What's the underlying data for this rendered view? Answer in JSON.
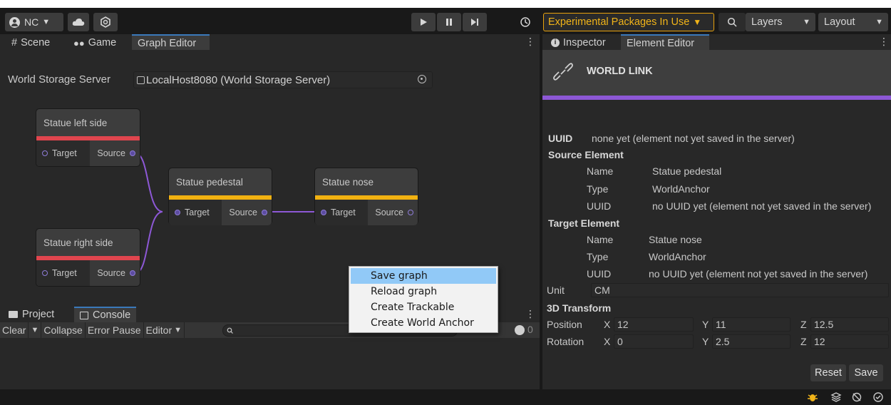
{
  "toolbar": {
    "account_label": "NC",
    "experimental_label": "Experimental Packages In Use",
    "layers_label": "Layers",
    "layout_label": "Layout"
  },
  "left_tabs": {
    "scene": "Scene",
    "game": "Game",
    "graph_editor": "Graph Editor"
  },
  "graph": {
    "world_storage_label": "World Storage Server",
    "world_storage_value": "LocalHost8080 (World Storage Server)",
    "nodes": [
      {
        "title": "Statue left side",
        "target": "Target",
        "source": "Source",
        "color": "#e0454e"
      },
      {
        "title": "Statue pedestal",
        "target": "Target",
        "source": "Source",
        "color": "#f2b211"
      },
      {
        "title": "Statue nose",
        "target": "Target",
        "source": "Source",
        "color": "#f2b211"
      },
      {
        "title": "Statue right side",
        "target": "Target",
        "source": "Source",
        "color": "#e0454e"
      }
    ],
    "link_color": "#8d58d6"
  },
  "context_menu": {
    "items": [
      "Save graph",
      "Reload graph",
      "Create Trackable",
      "Create World Anchor"
    ]
  },
  "bottom_tabs": {
    "project": "Project",
    "console": "Console"
  },
  "console": {
    "clear": "Clear",
    "collapse": "Collapse",
    "error_pause": "Error Pause",
    "editor": "Editor",
    "count_warn": "0",
    "count_err": "0"
  },
  "right_tabs": {
    "inspector": "Inspector",
    "element_editor": "Element Editor"
  },
  "inspector": {
    "title": "WORLD LINK",
    "uuid_label": "UUID",
    "uuid_value": "none yet (element not yet saved in the server)",
    "source_header": "Source Element",
    "source": {
      "name_label": "Name",
      "name": "Statue pedestal",
      "type_label": "Type",
      "type": "WorldAnchor",
      "uuid_label": "UUID",
      "uuid": "no UUID yet (element not yet saved in the server)"
    },
    "target_header": "Target Element",
    "target": {
      "name_label": "Name",
      "name": "Statue nose",
      "type_label": "Type",
      "type": "WorldAnchor",
      "uuid_label": "UUID",
      "uuid": "no UUID yet (element not yet saved in the server)"
    },
    "unit_label": "Unit",
    "unit_value": "CM",
    "transform_header": "3D Transform",
    "position_label": "Position",
    "position": {
      "x": "12",
      "y": "11",
      "z": "12.5"
    },
    "rotation_label": "Rotation",
    "rotation": {
      "x": "0",
      "y": "2.5",
      "z": "12"
    },
    "axis": {
      "x": "X",
      "y": "Y",
      "z": "Z"
    },
    "reset_label": "Reset",
    "save_label": "Save"
  }
}
